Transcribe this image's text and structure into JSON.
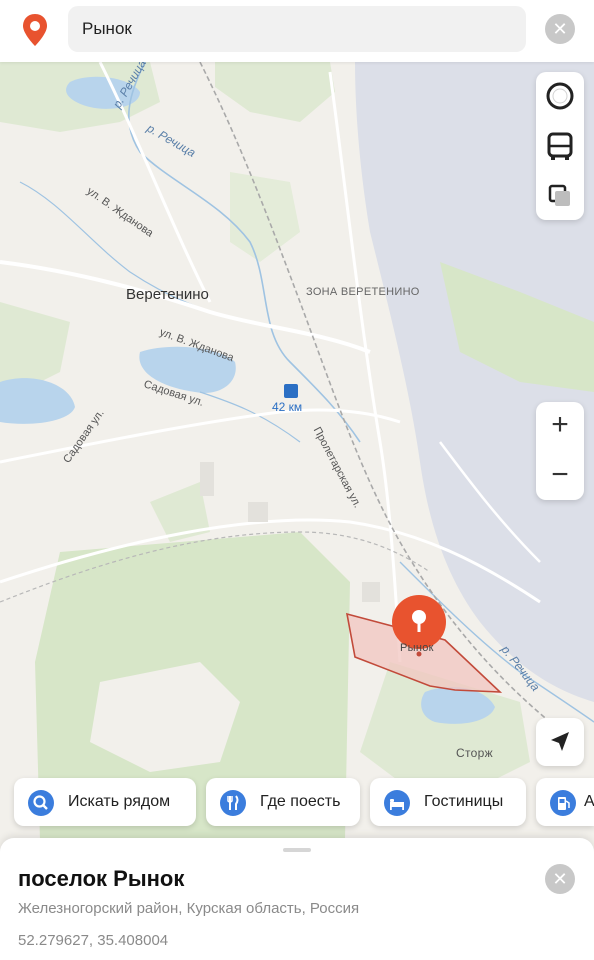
{
  "search": {
    "query": "Рынок",
    "clear_icon": "close-icon",
    "app_icon": "map-pin-icon"
  },
  "map": {
    "labels": {
      "river_top": "р. Речица",
      "river_mid": "р. Речица",
      "river_bottom": "р. Речица",
      "street_zhdanova_1": "ул. В. Жданова",
      "street_zhdanova_2": "ул. В. Жданова",
      "village": "Веретенино",
      "zone": "ЗОНА ВЕРЕТЕНИНО",
      "street_sadovaya_1": "Садовая ул.",
      "street_sadovaya_2": "Садовая ул.",
      "station": "42 км",
      "street_proletarskaya": "Пролетарская ул.",
      "place_label": "Рынок",
      "storzh": "Сторж"
    },
    "controls": {
      "layers": [
        "traffic-icon",
        "bus-icon",
        "layers-icon"
      ],
      "zoom_in": "+",
      "zoom_out": "−",
      "locate_icon": "navigation-arrow-icon"
    },
    "accent_pin_color": "#e8532f",
    "area_fill": "#f2c6c0",
    "area_stroke": "#c24a3a"
  },
  "chips": [
    {
      "label": "Искать рядом",
      "icon": "search-icon"
    },
    {
      "label": "Где поесть",
      "icon": "fork-knife-icon"
    },
    {
      "label": "Гостиницы",
      "icon": "bed-icon"
    },
    {
      "label": "А",
      "icon": "gas-station-icon"
    }
  ],
  "place": {
    "title": "поселок Рынок",
    "subtitle": "Железногорский район, Курская область, Россия",
    "coordinates": "52.279627, 35.408004",
    "close_icon": "close-icon"
  }
}
